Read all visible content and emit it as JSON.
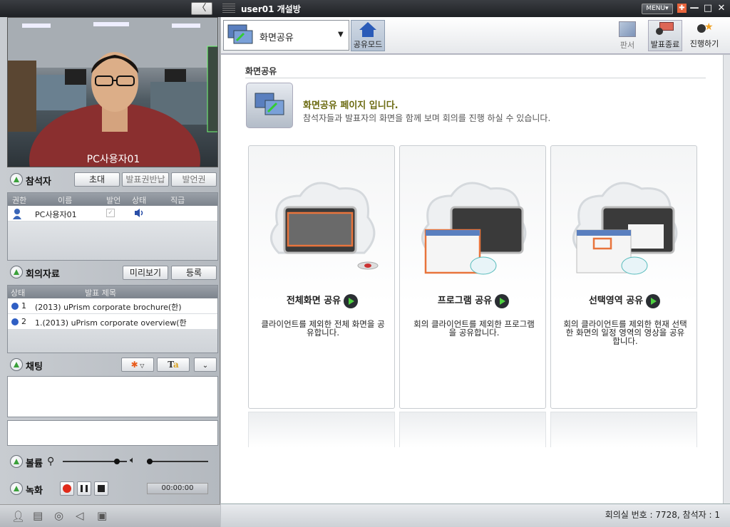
{
  "window": {
    "title": "user01 개설방",
    "menu_label": "MENU▾",
    "collapse_glyph": "〈",
    "minimize": "—",
    "maximize": "□",
    "close": "✕"
  },
  "video": {
    "user_label": "PC사용자01"
  },
  "participants": {
    "title": "참석자",
    "buttons": {
      "invite": "초대",
      "return_presenter": "발표권반납",
      "speak": "발언권"
    },
    "columns": [
      "권한",
      "이름",
      "발언",
      "상태",
      "직급"
    ],
    "rows": [
      {
        "name": "PC사용자01",
        "speak": "✓",
        "status": "speaker-icon",
        "rank": ""
      }
    ]
  },
  "materials": {
    "title": "회의자료",
    "buttons": {
      "preview": "미리보기",
      "register": "등록"
    },
    "columns": [
      "상태",
      "발표 제목"
    ],
    "rows": [
      {
        "num": "1",
        "title": "(2013) uPrism corporate brochure(한)"
      },
      {
        "num": "2",
        "title": "1.(2013) uPrism corporate overview(한"
      }
    ]
  },
  "chat": {
    "title": "채팅"
  },
  "volume": {
    "title": "볼륨",
    "mic_level": 0.84,
    "speaker_level": 0.05
  },
  "recording": {
    "title": "녹화",
    "time": "00:00:00"
  },
  "toolbar": {
    "mode": "화면공유",
    "share_mode": "공유모드",
    "whiteboard": "판서",
    "end_presentation": "발표종료",
    "host": "진행하기"
  },
  "main": {
    "section_title": "화면공유",
    "heading": "화면공유 페이지 입니다.",
    "subheading": "참석자들과 발표자의 화면을 함께 보며 회의를 진행 하실 수 있습니다.",
    "cards": [
      {
        "title": "전체화면 공유",
        "desc": "클라이언트를 제외한 전체 화면을 공유합니다."
      },
      {
        "title": "프로그램 공유",
        "desc": "회의 클라이언트를 제외한 프로그램을 공유합니다."
      },
      {
        "title": "선택영역 공유",
        "desc": "회의 클라이언트를 제외한 현재 선택한 화면의 일정 영역의 영상을 공유 합니다."
      }
    ]
  },
  "status": {
    "text": "회의실 번호 : 7728, 참석자 : 1"
  },
  "colors": {
    "accent_orange": "#e8743c",
    "play_green": "#4ed040",
    "heading_olive": "#6b6a10"
  }
}
